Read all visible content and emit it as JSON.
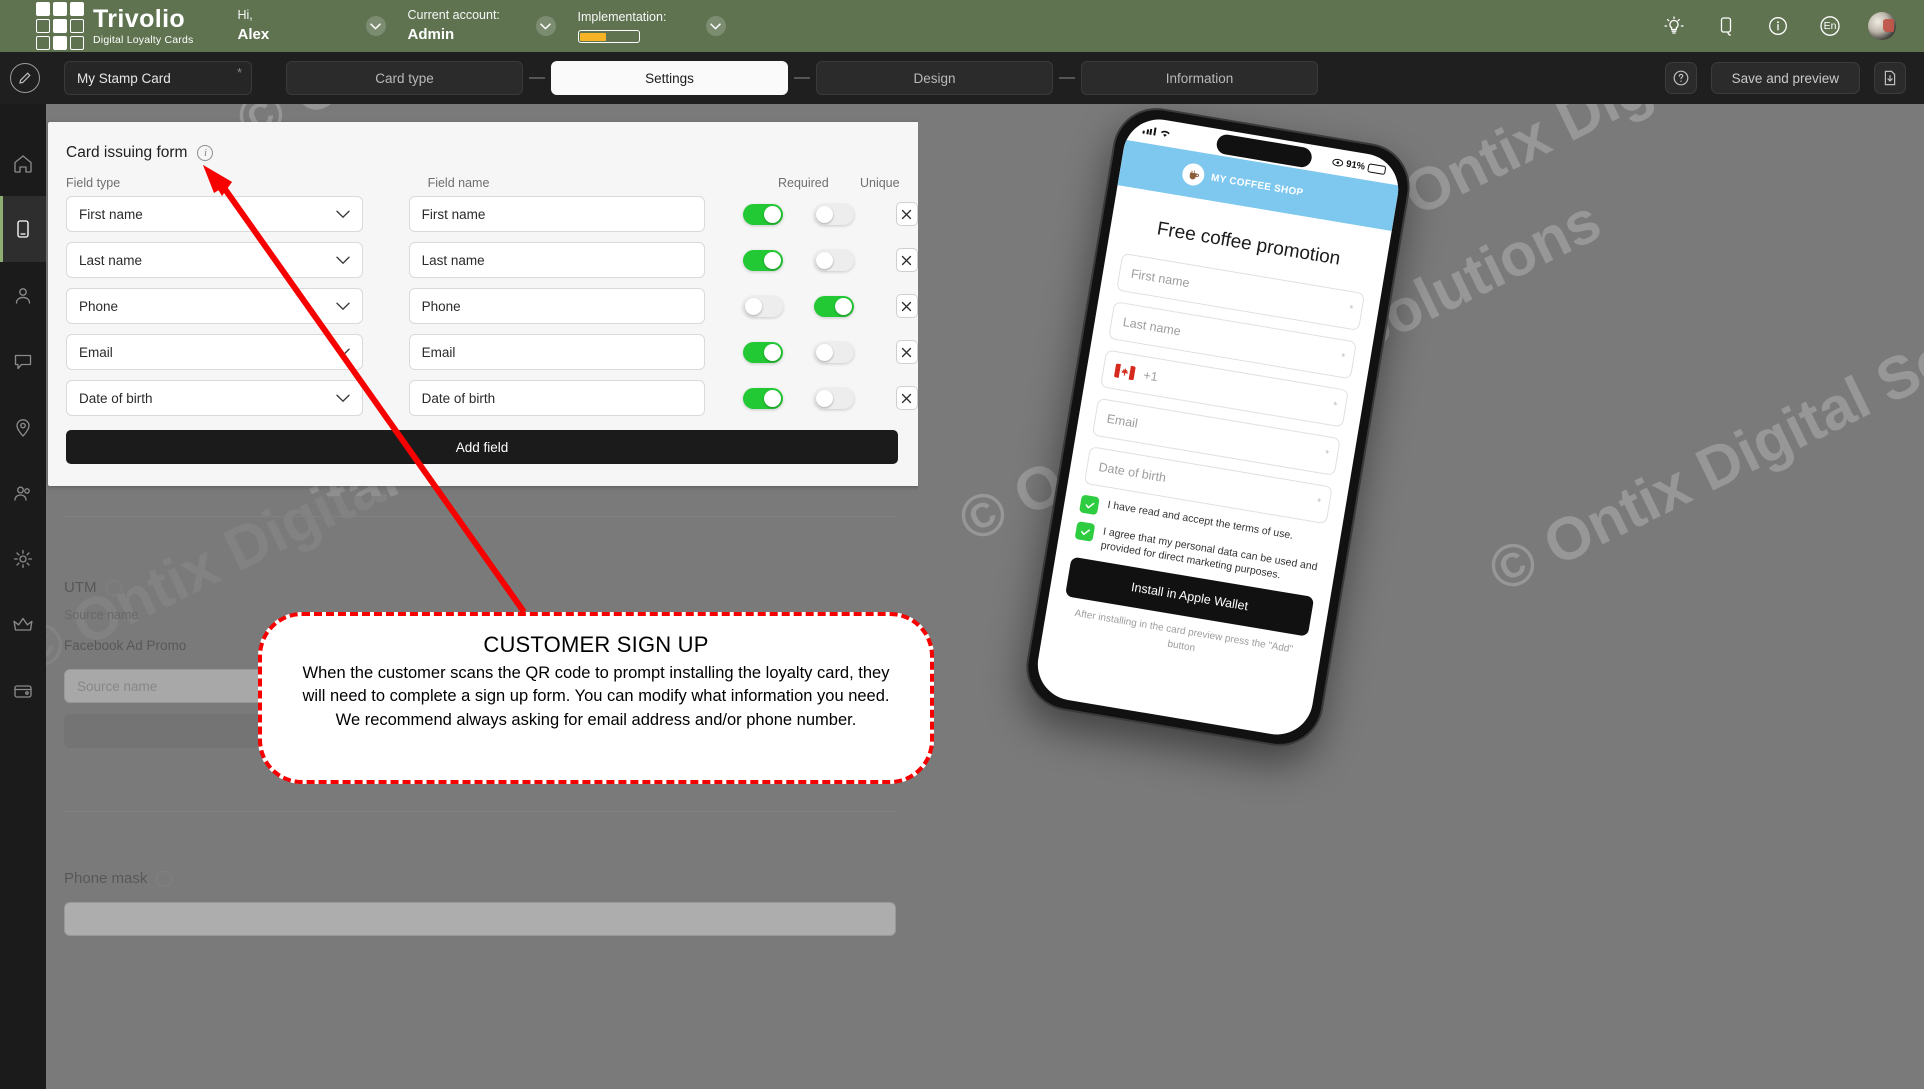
{
  "header": {
    "brand_name": "Trivolio",
    "brand_tagline": "Digital Loyalty Cards",
    "greeting_label": "Hi,",
    "greeting_value": "Alex",
    "account_label": "Current account:",
    "account_value": "Admin",
    "implementation_label": "Implementation:",
    "implementation_percent": 45,
    "language": "En",
    "icons": [
      "lightbulb-icon",
      "mobile-icon",
      "info-icon",
      "language-icon",
      "avatar"
    ]
  },
  "toolbar": {
    "card_name": "My Stamp Card",
    "required_marker": "*",
    "steps": [
      {
        "label": "Card type",
        "active": false
      },
      {
        "label": "Settings",
        "active": true
      },
      {
        "label": "Design",
        "active": false
      },
      {
        "label": "Information",
        "active": false
      }
    ],
    "help_label": "?",
    "save_label": "Save and preview"
  },
  "sidebar": {
    "items": [
      {
        "name": "sidebar-item-dashboard",
        "icon": "home-icon",
        "active": false
      },
      {
        "name": "sidebar-item-cards",
        "icon": "card-icon",
        "active": true
      },
      {
        "name": "sidebar-item-customers",
        "icon": "users-icon",
        "active": false
      },
      {
        "name": "sidebar-item-messages",
        "icon": "chat-icon",
        "active": false
      },
      {
        "name": "sidebar-item-locations",
        "icon": "pin-icon",
        "active": false
      },
      {
        "name": "sidebar-item-staff",
        "icon": "user-group-icon",
        "active": false
      },
      {
        "name": "sidebar-item-settings",
        "icon": "gear-icon",
        "active": false
      },
      {
        "name": "sidebar-item-loyalty",
        "icon": "crown-icon",
        "active": false
      },
      {
        "name": "sidebar-item-billing",
        "icon": "wallet-icon",
        "active": false
      }
    ]
  },
  "card_issuing_form": {
    "title": "Card issuing form",
    "columns": {
      "field_type": "Field type",
      "field_name": "Field name",
      "required": "Required",
      "unique": "Unique"
    },
    "rows": [
      {
        "type": "First name",
        "name": "First name",
        "required": true,
        "unique": false
      },
      {
        "type": "Last name",
        "name": "Last name",
        "required": true,
        "unique": false
      },
      {
        "type": "Phone",
        "name": "Phone",
        "required": false,
        "unique": true
      },
      {
        "type": "Email",
        "name": "Email",
        "required": true,
        "unique": false
      },
      {
        "type": "Date of birth",
        "name": "Date of birth",
        "required": true,
        "unique": false
      }
    ],
    "add_field_label": "Add field"
  },
  "utm_section": {
    "title": "UTM",
    "source_name_label": "Source name",
    "source_name_value": "Facebook Ad Promo",
    "source_name_placeholder": "Source name"
  },
  "phone_mask_section": {
    "title": "Phone mask"
  },
  "phone_preview": {
    "status_time": "",
    "battery_percent": "91%",
    "shop_name": "MY COFFEE SHOP",
    "promo_title": "Free coffee promotion",
    "fields": [
      {
        "placeholder": "First name",
        "required_star": "*"
      },
      {
        "placeholder": "Last name",
        "required_star": "*"
      },
      {
        "placeholder": "+1",
        "required_star": "*",
        "has_flag": true
      },
      {
        "placeholder": "Email",
        "required_star": "*"
      },
      {
        "placeholder": "Date of birth",
        "required_star": "*"
      }
    ],
    "consents": [
      "I have read and accept the terms of use.",
      "I agree that my personal data can be used and provided for direct marketing purposes."
    ],
    "install_button": "Install in Apple Wallet",
    "after_note": "After installing in the card preview press the \"Add\" button"
  },
  "annotation": {
    "title": "CUSTOMER SIGN UP",
    "body": "When the customer scans the QR code to prompt installing the loyalty card, they will need to complete a sign up form.  You can modify what information you need.  We recommend always asking for email address and/or phone number.",
    "arrow_color": "#f60000",
    "border_color": "#f60000"
  },
  "watermark": {
    "text": "© Ontix Digital Solutions"
  },
  "colors": {
    "header_green": "#5f7351",
    "toolbar_dark": "#1f1f1f",
    "toggle_on": "#23c934",
    "accent_blue": "#7ec8f0",
    "progress_orange": "#f5b325"
  }
}
